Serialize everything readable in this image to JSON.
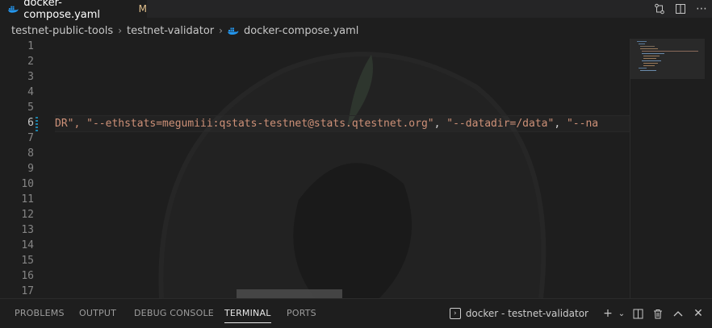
{
  "tab": {
    "filename": "docker-compose.yaml",
    "status": "M",
    "icon": "docker-icon"
  },
  "tab_actions": [
    "open-changes-icon",
    "split-editor-icon",
    "more-actions-icon"
  ],
  "breadcrumb": {
    "items": [
      "testnet-public-tools",
      "testnet-validator",
      "docker-compose.yaml"
    ]
  },
  "editor": {
    "line_numbers": [
      "1",
      "2",
      "3",
      "4",
      "5",
      "6",
      "7",
      "8",
      "9",
      "10",
      "11",
      "12",
      "13",
      "14",
      "15",
      "16",
      "17"
    ],
    "active_line": "6",
    "line6": {
      "p1": "DR",
      "p2": "\", ",
      "s1": "\"--ethstats=megumiii:qstats-testnet@stats.qtestnet.org\"",
      "p3": ", ",
      "s2": "\"--datadir=/data\"",
      "p4": ", ",
      "s3": "\"--na"
    }
  },
  "panel": {
    "tabs": [
      "PROBLEMS",
      "OUTPUT",
      "DEBUG CONSOLE",
      "TERMINAL",
      "PORTS"
    ],
    "active_tab": "TERMINAL",
    "terminal_name": "docker - testnet-validator"
  },
  "colors": {
    "string": "#ce9178",
    "editor_bg": "#1e1e1e",
    "modified": "#e2c08d",
    "gutter_modified": "#1b81a8"
  }
}
